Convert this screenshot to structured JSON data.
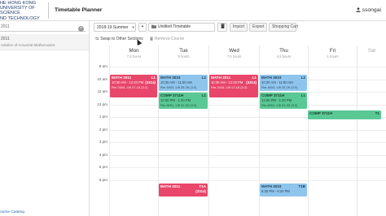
{
  "header": {
    "logo_lines": [
      "HE HONG KONG",
      "UNIVERSITY OF SCIENCE",
      "ND TECHNOLOGY"
    ],
    "app_title": "Timetable Planner",
    "user_name": "ssongai",
    "user_icon": "user-icon"
  },
  "sidebar": {
    "search_value": "2011",
    "clear_icon": "close-icon",
    "course_code": "2011",
    "course_name": "ndation of Actuarial Mathematics",
    "footer_link": "ourse Catalog"
  },
  "toolbar": {
    "term": "2018-19 Summer",
    "add_label": "+",
    "timetable_name": "Untitled Timetable",
    "delete_icon": "trash-icon",
    "import_label": "Import",
    "export_label": "Export",
    "cart_label": "Shopping Cart"
  },
  "actions": {
    "swap_label": "Swap to Other Sections",
    "remove_label": "Remove Course",
    "swap_icon": "swap-icon",
    "remove_icon": "trash-icon"
  },
  "calendar": {
    "days": [
      {
        "name": "Mon",
        "hours": "7.5 hours"
      },
      {
        "name": "Tue",
        "hours": "5 hours"
      },
      {
        "name": "Wed",
        "hours": "7.5 hours"
      },
      {
        "name": "Thu",
        "hours": "4.5 hours"
      },
      {
        "name": "Fri",
        "hours": "1 hours"
      },
      {
        "name": "Sat",
        "hours": ""
      }
    ],
    "times": [
      "9 am",
      "10 am",
      "11 am",
      "12 pm",
      "1 pm",
      "2 pm",
      "3 pm",
      "4 pm",
      "5 pm",
      "6 pm"
    ],
    "events": [
      {
        "day": "Mon",
        "course": "MATH 2011",
        "section": "L1",
        "seat": "(3314)",
        "time": "10:30 AM - 12:20 PM",
        "room": "Rm 2404, Lift 17-18 (3.2)",
        "color": "red"
      },
      {
        "day": "Tue",
        "course": "MATH 3033",
        "section": "L2",
        "seat": "",
        "time": "10:30 AM - 11:50 AM",
        "room": "Rm 4503, Lift 25-26 (3.0)",
        "color": "blue"
      },
      {
        "day": "Tue",
        "course": "COMP 3711H",
        "section": "L1",
        "seat": "",
        "time": "12:00 PM - 1:20 PM",
        "room": "Rm 6591, Lift 31-32 (3.0)",
        "color": "green"
      },
      {
        "day": "Wed",
        "course": "MATH 2011",
        "section": "L1",
        "seat": "(3314)",
        "time": "10:30 AM - 12:20 PM",
        "room": "Rm 2404, Lift 17-18 (3.2)",
        "color": "red"
      },
      {
        "day": "Thu",
        "course": "MATH 3033",
        "section": "L2",
        "seat": "",
        "time": "10:30 AM - 11:50 AM",
        "room": "Rm 4503, Lift 25-26 (3.0)",
        "color": "blue"
      },
      {
        "day": "Thu",
        "course": "COMP 3711H",
        "section": "L1",
        "seat": "",
        "time": "12:00 PM - 1:20 PM",
        "room": "Rm 6591, Lift 31-32 (3.0)",
        "color": "green"
      },
      {
        "day": "Fri",
        "course": "COMP 3711H",
        "section": "T1",
        "seat": "",
        "time": "",
        "room": "",
        "color": "green"
      },
      {
        "day": "Tue",
        "course": "MATH 2011",
        "section": "T1A",
        "seat": "(3314)",
        "time": "",
        "room": "",
        "color": "red"
      },
      {
        "day": "Thu",
        "course": "MATH 3033",
        "section": "T1B",
        "seat": "",
        "time": "5:30 PM - 6:20 PM",
        "room": "",
        "color": "blue"
      }
    ]
  }
}
